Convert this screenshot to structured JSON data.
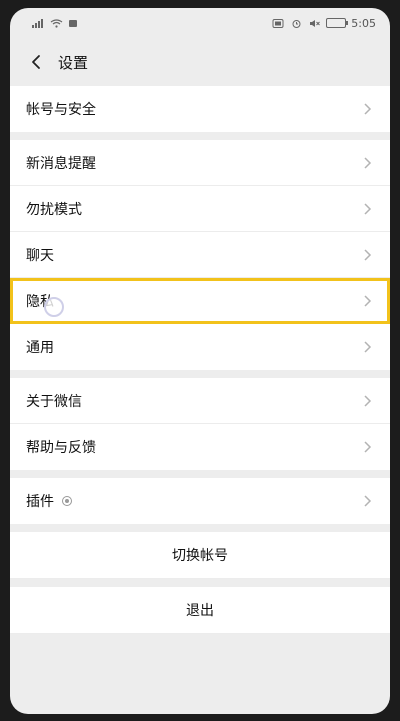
{
  "status_bar": {
    "time": "5:05"
  },
  "header": {
    "title": "设置"
  },
  "settings": {
    "account_security": "帐号与安全",
    "new_message_notify": "新消息提醒",
    "do_not_disturb": "勿扰模式",
    "chat": "聊天",
    "privacy": "隐私",
    "general": "通用",
    "about_wechat": "关于微信",
    "help_feedback": "帮助与反馈",
    "plugins": "插件"
  },
  "actions": {
    "switch_account": "切换帐号",
    "logout": "退出"
  },
  "colors": {
    "highlight": "#f2c21b"
  }
}
